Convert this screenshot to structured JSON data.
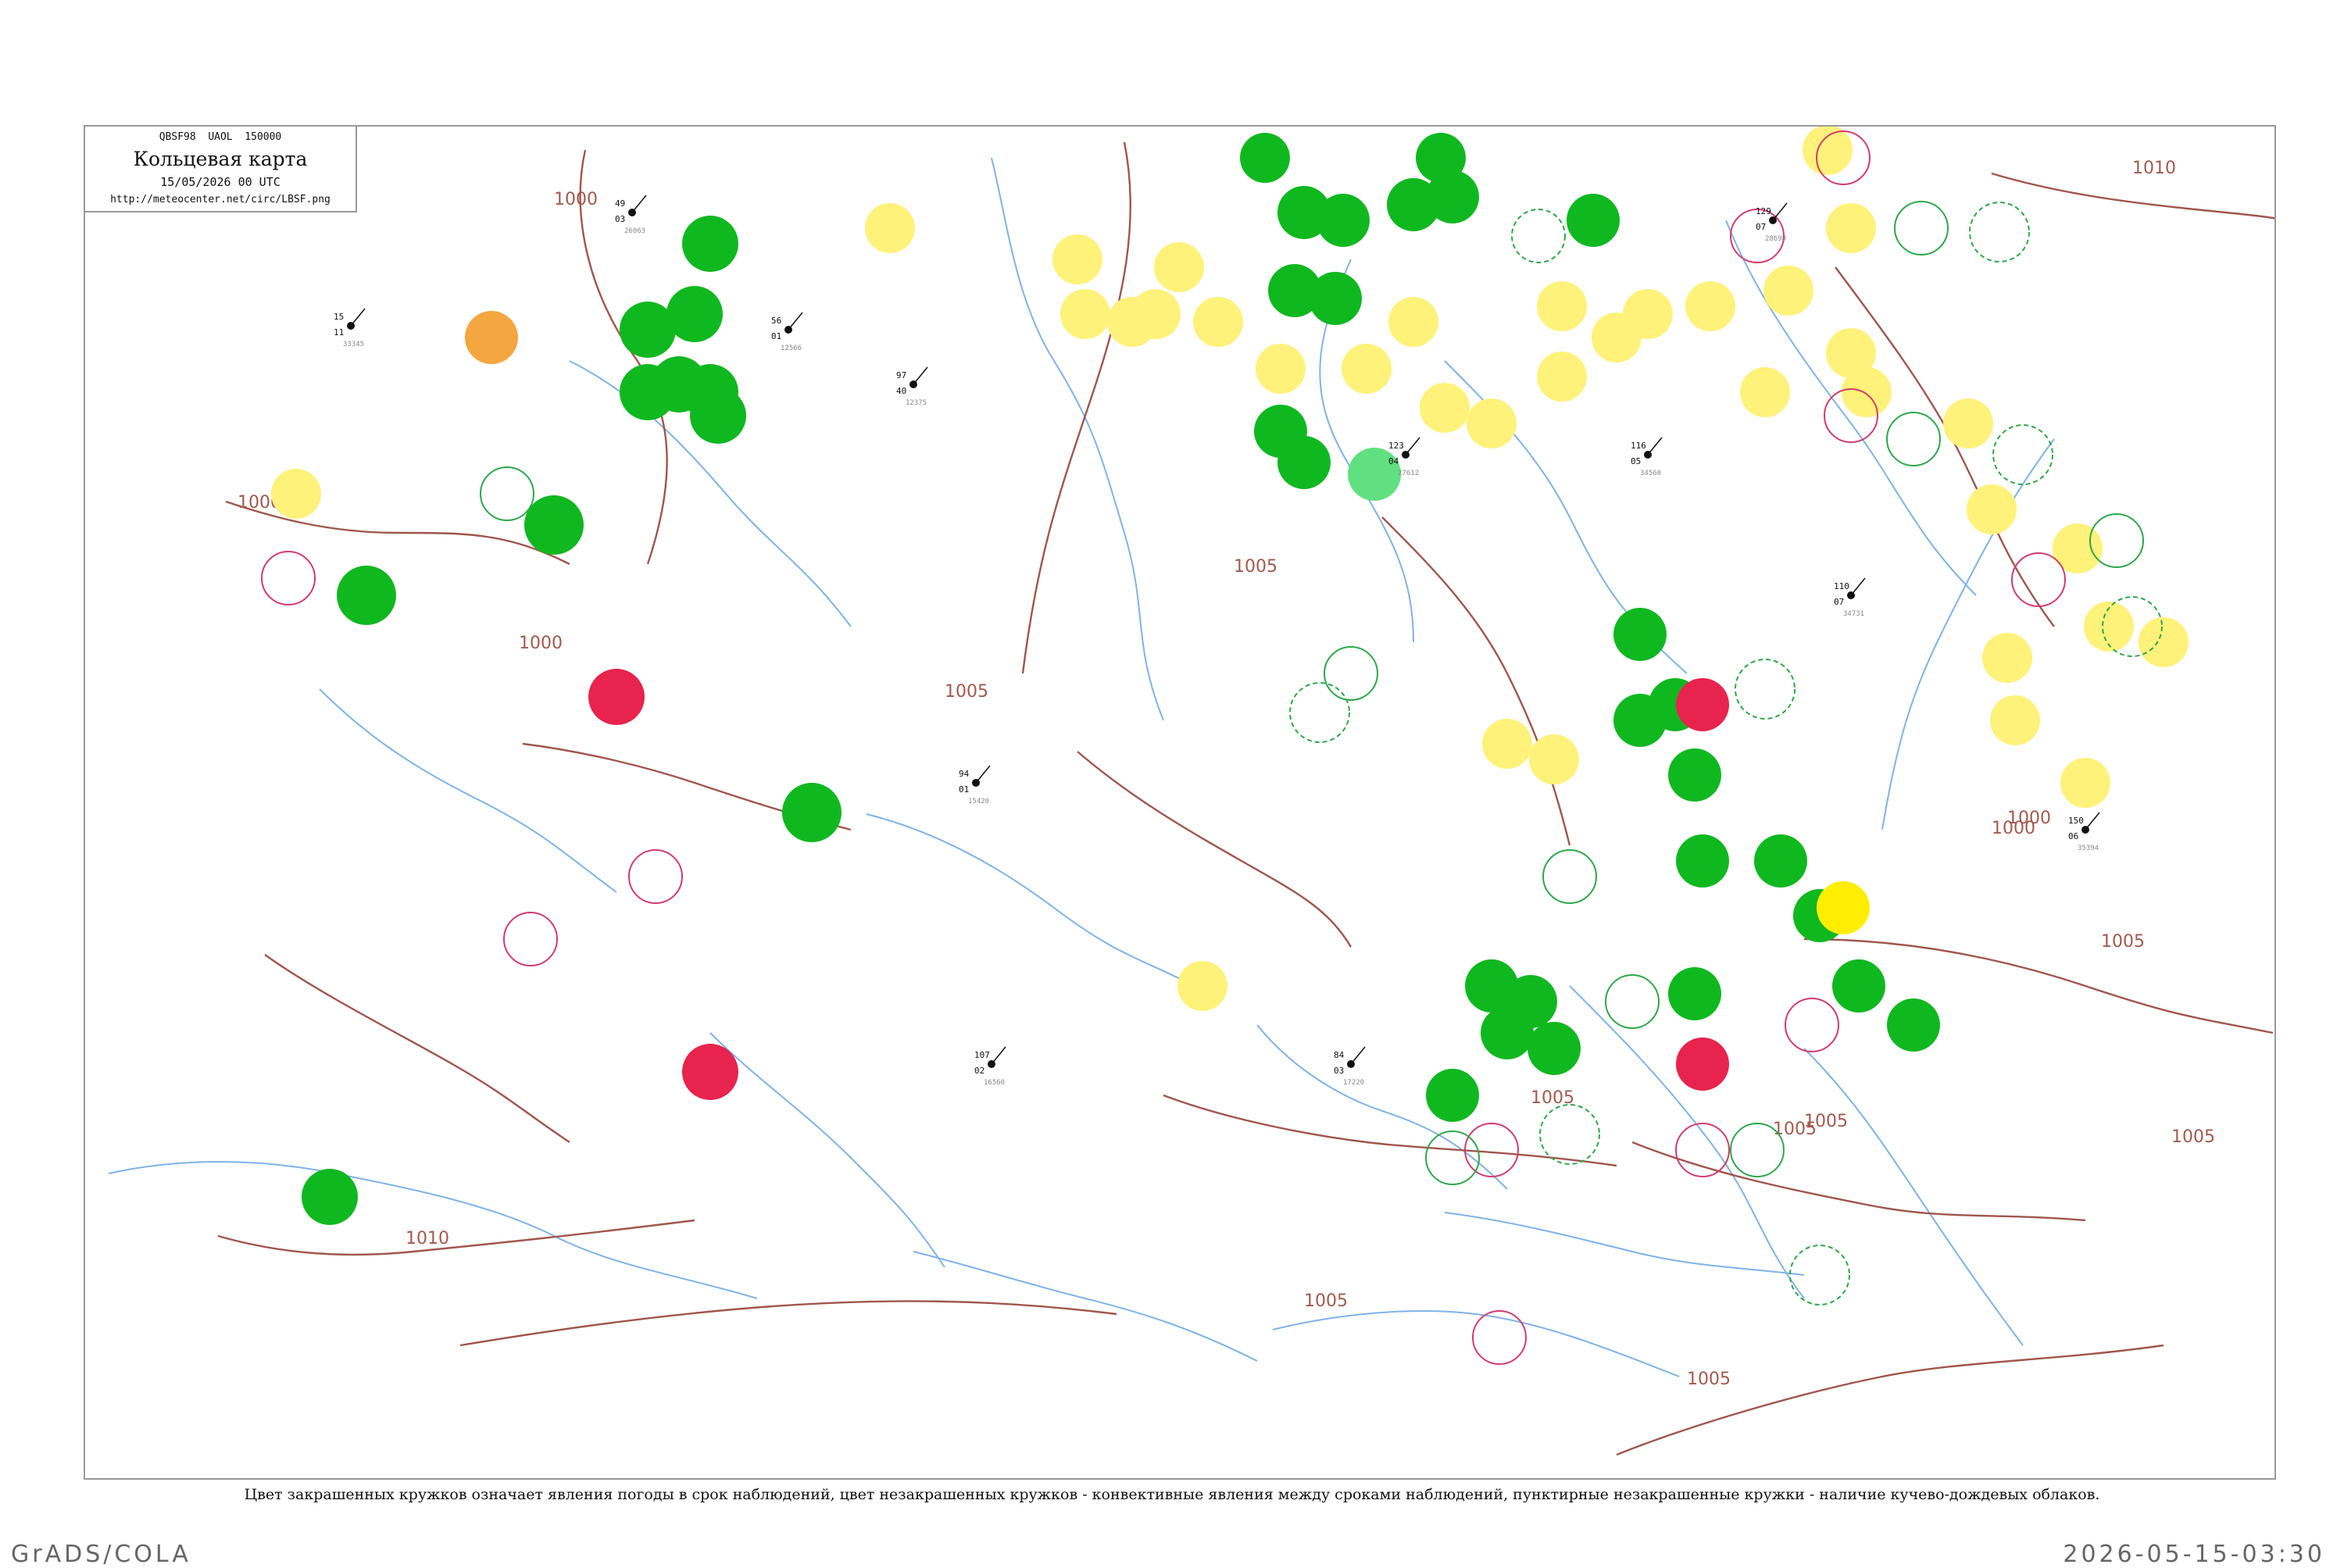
{
  "header": {
    "codes": "QBSF98  UAOL  150000",
    "title": "Кольцевая карта",
    "datetime": "15/05/2026 00 UTC",
    "url": "http://meteocenter.net/circ/LBSF.png"
  },
  "caption": "Цвет закрашенных кружков означает явления погоды в срок наблюдений, цвет незакрашенных кружков - конвективные явления между сроками наблюдений, пунктирные незакрашенные кружки - наличие кучево-дождевых облаков.",
  "footer": {
    "left": "GrADS/COLA",
    "right": "2026-05-15-03:30"
  },
  "colors": {
    "isobar": "#a0564e",
    "river": "#7fb3e8",
    "green": "#10b820",
    "light_green": "#60e080",
    "yellow": "#fff27a",
    "bright_yellow": "#ffee00",
    "orange": "#f4a640",
    "red": "#e8234e",
    "ring_green": "#2ea84a",
    "ring_red": "#d23c6c"
  },
  "isobar_labels": [
    "1000",
    "1000",
    "1000",
    "1000",
    "1005",
    "1005",
    "1005",
    "1005",
    "1005",
    "1005",
    "1005",
    "1010",
    "1010",
    "1005",
    "1000",
    "1005"
  ],
  "stations": [
    {
      "t": "15",
      "d": "11",
      "id": "33345"
    },
    {
      "t": "49",
      "d": "03",
      "id": "26063"
    },
    {
      "t": "56",
      "d": "01",
      "id": "12566"
    },
    {
      "t": "97",
      "d": "40",
      "id": "12375"
    },
    {
      "t": "123",
      "d": "04",
      "id": "27612"
    },
    {
      "t": "116",
      "d": "05",
      "id": "34560"
    },
    {
      "t": "110",
      "d": "07",
      "id": "34731"
    },
    {
      "t": "150",
      "d": "06",
      "id": "35394"
    },
    {
      "t": "129",
      "d": "07",
      "id": "28698"
    },
    {
      "t": "94",
      "d": "01",
      "id": "15420"
    },
    {
      "t": "107",
      "d": "02",
      "id": "16560"
    },
    {
      "t": "84",
      "d": "03",
      "id": "17220"
    }
  ]
}
